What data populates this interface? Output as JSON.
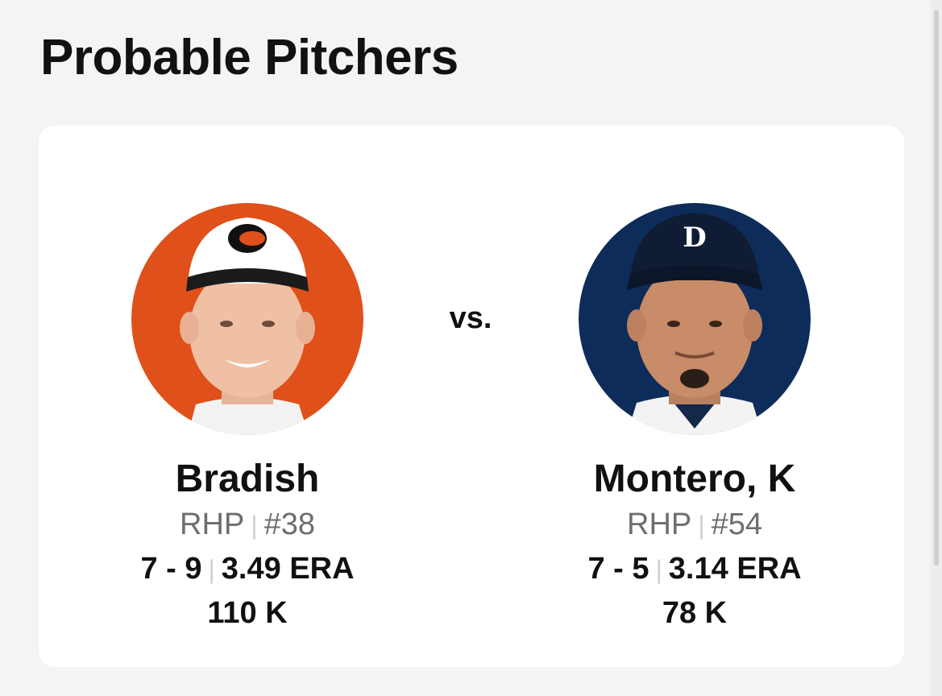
{
  "page": {
    "title": "Probable Pitchers",
    "vs_label": "vs."
  },
  "pitchers": [
    {
      "name": "Bradish",
      "hand": "RHP",
      "number": "#38",
      "record": "7 - 9",
      "era": "3.49 ERA",
      "strikeouts": "110 K",
      "avatar_color": "#e0501a",
      "cap_color": "#ffffff",
      "brim_color": "#1b1b1b"
    },
    {
      "name": "Montero, K",
      "hand": "RHP",
      "number": "#54",
      "record": "7 - 5",
      "era": "3.14 ERA",
      "strikeouts": "78 K",
      "avatar_color": "#0e2c5a",
      "cap_color": "#0f1c34",
      "brim_color": "#0f1c34"
    }
  ],
  "separator": "|"
}
